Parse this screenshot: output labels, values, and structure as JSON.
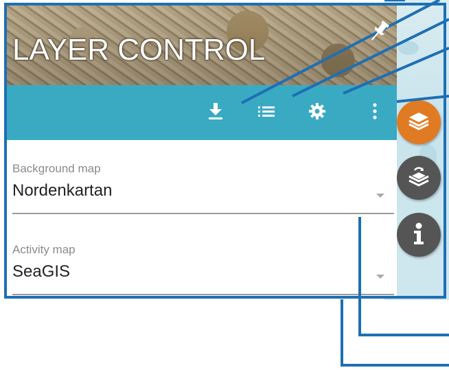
{
  "panel": {
    "title": "LAYER CONTROL"
  },
  "toolbar": {
    "buttons": [
      {
        "icon": "download-icon"
      },
      {
        "icon": "list-icon"
      },
      {
        "icon": "gear-icon"
      },
      {
        "icon": "more-vertical-icon"
      }
    ]
  },
  "fields": {
    "background_map": {
      "label": "Background map",
      "value": "Nordenkartan"
    },
    "activity_map": {
      "label": "Activity map",
      "value": "SeaGIS"
    }
  },
  "side_buttons": [
    {
      "icon": "layers-icon",
      "color": "#e07b24"
    },
    {
      "icon": "layers-sync-icon",
      "color": "#555555"
    },
    {
      "icon": "info-icon",
      "color": "#555555"
    }
  ],
  "colors": {
    "toolbar": "#3aaac3",
    "annotation": "#1e6fb4",
    "active_side_button": "#e07b24"
  }
}
